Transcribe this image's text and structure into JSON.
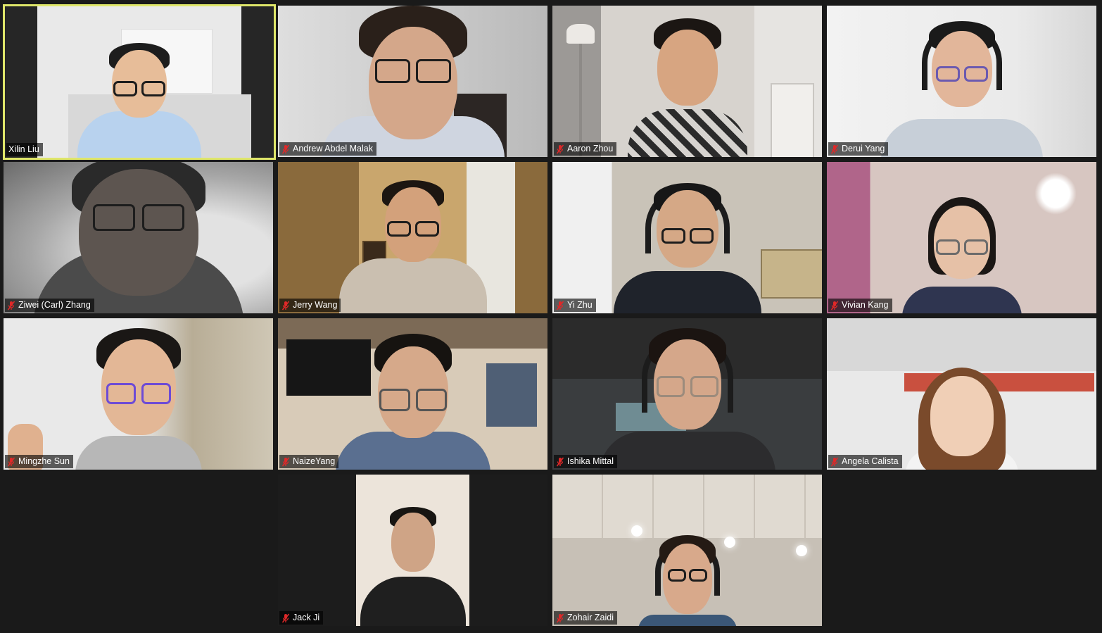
{
  "participants": [
    {
      "name": "Xilin Liu",
      "muted": false,
      "active_speaker": true
    },
    {
      "name": "Andrew Abdel Malak",
      "muted": true
    },
    {
      "name": "Aaron Zhou",
      "muted": true
    },
    {
      "name": "Derui Yang",
      "muted": true
    },
    {
      "name": "Ziwei (Carl) Zhang",
      "muted": true
    },
    {
      "name": "Jerry Wang",
      "muted": true
    },
    {
      "name": "Yi Zhu",
      "muted": true
    },
    {
      "name": "Vivian Kang",
      "muted": true
    },
    {
      "name": "Mingzhe Sun",
      "muted": true
    },
    {
      "name": "NaizeYang",
      "muted": true
    },
    {
      "name": "Ishika Mittal",
      "muted": true
    },
    {
      "name": "Angela Calista",
      "muted": true
    },
    {
      "name": "Jack Ji",
      "muted": true
    },
    {
      "name": "Zohair Zaidi",
      "muted": true
    }
  ],
  "colors": {
    "background": "#1a1a1a",
    "active_speaker_border": "#dfe66a",
    "muted_icon": "#e02828",
    "nameplate_text": "#ffffff"
  },
  "icons": {
    "muted": "mic-muted-icon"
  }
}
